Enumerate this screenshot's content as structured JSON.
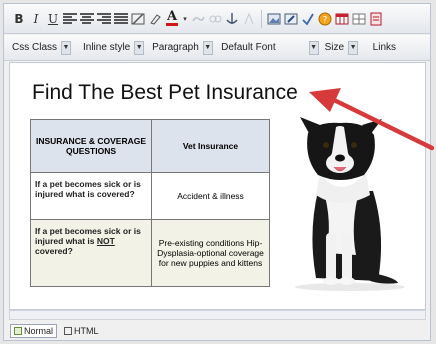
{
  "toolbar": {
    "bold": "B",
    "italic": "I",
    "underline": "U",
    "font_color": "A",
    "style_dropdowns": [
      {
        "id": "css-class",
        "value": "Css Class"
      },
      {
        "id": "inline-style",
        "value": "Inline style"
      },
      {
        "id": "paragraph",
        "value": "Paragraph"
      },
      {
        "id": "font",
        "value": "Default Font"
      },
      {
        "id": "size",
        "value": "Size"
      },
      {
        "id": "links",
        "value": "Links"
      }
    ]
  },
  "document": {
    "heading": "Find The Best Pet Insurance",
    "table": {
      "headers": [
        "INSURANCE & COVERAGE QUESTIONS",
        "Vet Insurance"
      ],
      "rows": [
        {
          "question": "If a pet becomes sick or is injured what is covered?",
          "answer": "Accident & illness"
        },
        {
          "question_pre": "If a pet becomes sick or is injured what is ",
          "question_emph": "NOT",
          "question_post": " covered?",
          "answer": "Pre-existing conditions Hip-Dysplasia-optional coverage for new puppies and kittens"
        }
      ]
    }
  },
  "tabs": [
    {
      "label": "Normal",
      "active": true
    },
    {
      "label": "HTML",
      "active": false
    }
  ],
  "colors": {
    "arrow": "#d63a3a",
    "table_header_bg": "#dde3ec",
    "font_color_bar": "#d01818"
  }
}
